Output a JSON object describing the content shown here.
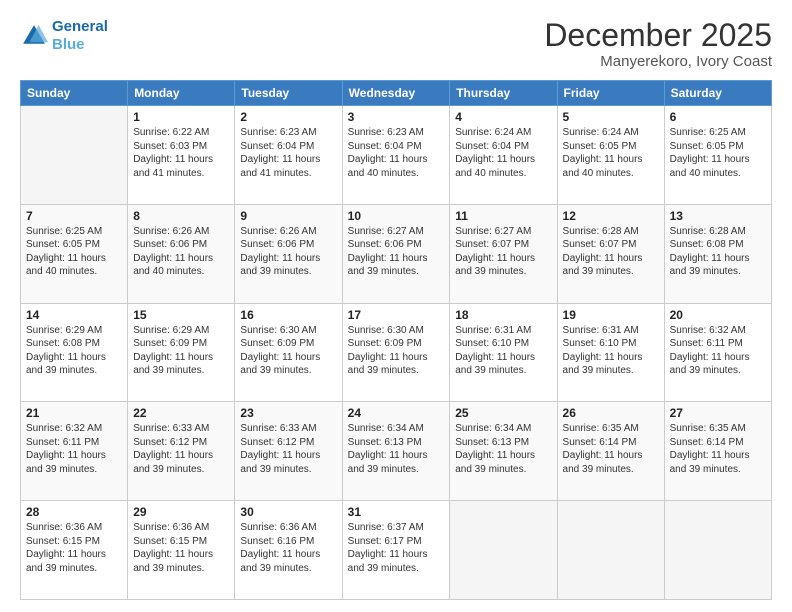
{
  "header": {
    "logo_line1": "General",
    "logo_line2": "Blue",
    "main_title": "December 2025",
    "subtitle": "Manyerekoro, Ivory Coast"
  },
  "calendar": {
    "days_of_week": [
      "Sunday",
      "Monday",
      "Tuesday",
      "Wednesday",
      "Thursday",
      "Friday",
      "Saturday"
    ],
    "weeks": [
      [
        {
          "day": "",
          "info": ""
        },
        {
          "day": "1",
          "info": "Sunrise: 6:22 AM\nSunset: 6:03 PM\nDaylight: 11 hours and 41 minutes."
        },
        {
          "day": "2",
          "info": "Sunrise: 6:23 AM\nSunset: 6:04 PM\nDaylight: 11 hours and 41 minutes."
        },
        {
          "day": "3",
          "info": "Sunrise: 6:23 AM\nSunset: 6:04 PM\nDaylight: 11 hours and 40 minutes."
        },
        {
          "day": "4",
          "info": "Sunrise: 6:24 AM\nSunset: 6:04 PM\nDaylight: 11 hours and 40 minutes."
        },
        {
          "day": "5",
          "info": "Sunrise: 6:24 AM\nSunset: 6:05 PM\nDaylight: 11 hours and 40 minutes."
        },
        {
          "day": "6",
          "info": "Sunrise: 6:25 AM\nSunset: 6:05 PM\nDaylight: 11 hours and 40 minutes."
        }
      ],
      [
        {
          "day": "7",
          "info": "Sunrise: 6:25 AM\nSunset: 6:05 PM\nDaylight: 11 hours and 40 minutes."
        },
        {
          "day": "8",
          "info": "Sunrise: 6:26 AM\nSunset: 6:06 PM\nDaylight: 11 hours and 40 minutes."
        },
        {
          "day": "9",
          "info": "Sunrise: 6:26 AM\nSunset: 6:06 PM\nDaylight: 11 hours and 39 minutes."
        },
        {
          "day": "10",
          "info": "Sunrise: 6:27 AM\nSunset: 6:06 PM\nDaylight: 11 hours and 39 minutes."
        },
        {
          "day": "11",
          "info": "Sunrise: 6:27 AM\nSunset: 6:07 PM\nDaylight: 11 hours and 39 minutes."
        },
        {
          "day": "12",
          "info": "Sunrise: 6:28 AM\nSunset: 6:07 PM\nDaylight: 11 hours and 39 minutes."
        },
        {
          "day": "13",
          "info": "Sunrise: 6:28 AM\nSunset: 6:08 PM\nDaylight: 11 hours and 39 minutes."
        }
      ],
      [
        {
          "day": "14",
          "info": "Sunrise: 6:29 AM\nSunset: 6:08 PM\nDaylight: 11 hours and 39 minutes."
        },
        {
          "day": "15",
          "info": "Sunrise: 6:29 AM\nSunset: 6:09 PM\nDaylight: 11 hours and 39 minutes."
        },
        {
          "day": "16",
          "info": "Sunrise: 6:30 AM\nSunset: 6:09 PM\nDaylight: 11 hours and 39 minutes."
        },
        {
          "day": "17",
          "info": "Sunrise: 6:30 AM\nSunset: 6:09 PM\nDaylight: 11 hours and 39 minutes."
        },
        {
          "day": "18",
          "info": "Sunrise: 6:31 AM\nSunset: 6:10 PM\nDaylight: 11 hours and 39 minutes."
        },
        {
          "day": "19",
          "info": "Sunrise: 6:31 AM\nSunset: 6:10 PM\nDaylight: 11 hours and 39 minutes."
        },
        {
          "day": "20",
          "info": "Sunrise: 6:32 AM\nSunset: 6:11 PM\nDaylight: 11 hours and 39 minutes."
        }
      ],
      [
        {
          "day": "21",
          "info": "Sunrise: 6:32 AM\nSunset: 6:11 PM\nDaylight: 11 hours and 39 minutes."
        },
        {
          "day": "22",
          "info": "Sunrise: 6:33 AM\nSunset: 6:12 PM\nDaylight: 11 hours and 39 minutes."
        },
        {
          "day": "23",
          "info": "Sunrise: 6:33 AM\nSunset: 6:12 PM\nDaylight: 11 hours and 39 minutes."
        },
        {
          "day": "24",
          "info": "Sunrise: 6:34 AM\nSunset: 6:13 PM\nDaylight: 11 hours and 39 minutes."
        },
        {
          "day": "25",
          "info": "Sunrise: 6:34 AM\nSunset: 6:13 PM\nDaylight: 11 hours and 39 minutes."
        },
        {
          "day": "26",
          "info": "Sunrise: 6:35 AM\nSunset: 6:14 PM\nDaylight: 11 hours and 39 minutes."
        },
        {
          "day": "27",
          "info": "Sunrise: 6:35 AM\nSunset: 6:14 PM\nDaylight: 11 hours and 39 minutes."
        }
      ],
      [
        {
          "day": "28",
          "info": "Sunrise: 6:36 AM\nSunset: 6:15 PM\nDaylight: 11 hours and 39 minutes."
        },
        {
          "day": "29",
          "info": "Sunrise: 6:36 AM\nSunset: 6:15 PM\nDaylight: 11 hours and 39 minutes."
        },
        {
          "day": "30",
          "info": "Sunrise: 6:36 AM\nSunset: 6:16 PM\nDaylight: 11 hours and 39 minutes."
        },
        {
          "day": "31",
          "info": "Sunrise: 6:37 AM\nSunset: 6:17 PM\nDaylight: 11 hours and 39 minutes."
        },
        {
          "day": "",
          "info": ""
        },
        {
          "day": "",
          "info": ""
        },
        {
          "day": "",
          "info": ""
        }
      ]
    ]
  }
}
